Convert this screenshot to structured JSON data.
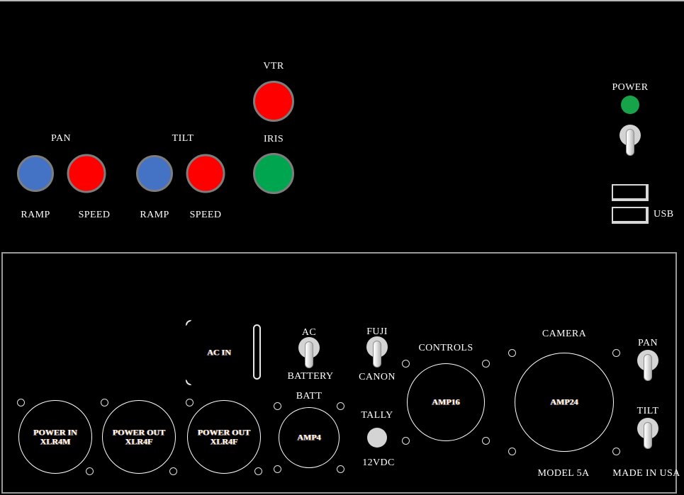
{
  "device": {
    "model_label": "MODEL 5A",
    "origin_label": "MADE IN USA"
  },
  "colors": {
    "panel_bg": "#000000",
    "panel_border": "#9a9a9a",
    "label_text": "#ffffff",
    "button_ring": "#7d7d7d",
    "blue_button": "#4472c4",
    "red_button": "#ff0000",
    "green_button": "#00a550",
    "power_led_green": "#16a34a",
    "tally_led_grey": "#d4d4d4",
    "usb_border": "#d8d8d8"
  },
  "top_panel": {
    "pan_group": {
      "title": "PAN",
      "ramp": {
        "label": "RAMP",
        "color_name": "blue"
      },
      "speed": {
        "label": "SPEED",
        "color_name": "red"
      }
    },
    "tilt_group": {
      "title": "TILT",
      "ramp": {
        "label": "RAMP",
        "color_name": "blue"
      },
      "speed": {
        "label": "SPEED",
        "color_name": "red"
      }
    },
    "vtr": {
      "label": "VTR",
      "color_name": "red"
    },
    "iris": {
      "label": "IRIS",
      "color_name": "green"
    },
    "power": {
      "label": "POWER",
      "led_state": "on",
      "switch_name": "power-toggle"
    },
    "usb": {
      "label": "USB",
      "port_count": 2
    }
  },
  "bottom_panel": {
    "power_in": {
      "line1": "POWER IN",
      "line2": "XLR4M"
    },
    "power_out_1": {
      "line1": "POWER OUT",
      "line2": "XLR4F"
    },
    "power_out_2": {
      "line1": "POWER OUT",
      "line2": "XLR4F"
    },
    "ac_in": {
      "label": "AC IN"
    },
    "ac_battery_switch": {
      "top_label": "AC",
      "bottom_label": "BATTERY"
    },
    "batt_connector": {
      "label": "BATT",
      "center_text": "AMP4"
    },
    "fuji_canon_switch": {
      "top_label": "FUJI",
      "bottom_label": "CANON"
    },
    "tally": {
      "top_label": "TALLY",
      "bottom_label": "12VDC"
    },
    "controls_connector": {
      "label": "CONTROLS",
      "center_text": "AMP16"
    },
    "camera_connector": {
      "label": "CAMERA",
      "center_text": "AMP24"
    },
    "pan_switch": {
      "label": "PAN"
    },
    "tilt_switch": {
      "label": "TILT"
    }
  }
}
